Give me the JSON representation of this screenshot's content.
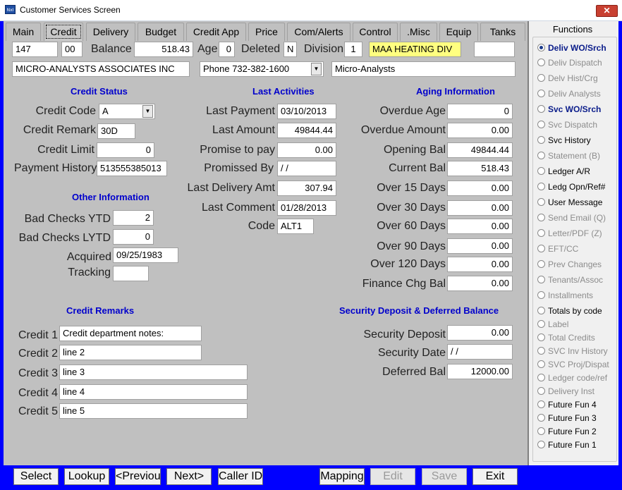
{
  "window": {
    "title": "Customer Services Screen",
    "icon": "app-icon",
    "close_label": "✕"
  },
  "tabs": [
    {
      "label": "Main",
      "hotkey": "M"
    },
    {
      "label": "Credit",
      "active": true
    },
    {
      "label": "Delivery"
    },
    {
      "label": "Budget"
    },
    {
      "label": "Credit App"
    },
    {
      "label": "Price"
    },
    {
      "label": "Com/Alerts"
    },
    {
      "label": "Control"
    },
    {
      "label": ".Misc"
    },
    {
      "label": "Equip"
    },
    {
      "label": "Tanks"
    }
  ],
  "header": {
    "account": "147",
    "sub": "00",
    "balance_label": "Balance",
    "balance": "518.43",
    "age_label": "Age",
    "age": "0",
    "deleted_label": "Deleted",
    "deleted": "N",
    "division_label": "Division",
    "division": "1",
    "division_name": "MAA HEATING  DIV",
    "extra": "",
    "customer_name": "MICRO-ANALYSTS ASSOCIATES INC",
    "phone": "Phone 732-382-1600",
    "short_name": "Micro-Analysts"
  },
  "credit_status": {
    "title": "Credit Status",
    "code_label": "Credit Code",
    "code": "A",
    "remark_label": "Credit Remark",
    "remark": "30D",
    "limit_label": "Credit Limit",
    "limit": "0",
    "history_label": "Payment History",
    "history": "513555385013"
  },
  "other_info": {
    "title": "Other Information",
    "bad_ytd_label": "Bad Checks YTD",
    "bad_ytd": "2",
    "bad_lytd_label": "Bad Checks LYTD",
    "bad_lytd": "0",
    "acquired_label": "Acquired",
    "acquired": "09/25/1983",
    "tracking_label": "Tracking",
    "tracking": ""
  },
  "last_activities": {
    "title": "Last Activities",
    "rows": [
      {
        "label": "Last Payment",
        "value": "03/10/2013"
      },
      {
        "label": "Last Amount",
        "value": "49844.44"
      },
      {
        "label": "Promise to pay",
        "value": "0.00"
      },
      {
        "label": "Promissed By",
        "value": " / /"
      },
      {
        "label": "Last Delivery Amt",
        "value": "307.94"
      },
      {
        "label": "Last Comment",
        "value": "01/28/2013"
      },
      {
        "label": "Code",
        "value": "ALT1"
      }
    ]
  },
  "aging": {
    "title": "Aging Information",
    "rows": [
      {
        "label": "Overdue Age",
        "value": "0"
      },
      {
        "label": "Overdue Amount",
        "value": "0.00"
      },
      {
        "label": "Opening Bal",
        "value": "49844.44"
      },
      {
        "label": "Current Bal",
        "value": "518.43"
      },
      {
        "label": "Over 15 Days",
        "value": "0.00"
      },
      {
        "label": "Over 30 Days",
        "value": "0.00"
      },
      {
        "label": "Over 60 Days",
        "value": "0.00"
      },
      {
        "label": "Over 90 Days",
        "value": "0.00"
      },
      {
        "label": "Over 120 Days",
        "value": "0.00"
      },
      {
        "label": "Finance Chg Bal",
        "value": "0.00"
      }
    ]
  },
  "credit_remarks": {
    "title": "Credit Remarks",
    "rows": [
      {
        "label": "Credit 1",
        "value": "Credit department notes:"
      },
      {
        "label": "Credit 2",
        "value": "line 2"
      },
      {
        "label": "Credit 3",
        "value": "line 3"
      },
      {
        "label": "Credit 4",
        "value": "line 4"
      },
      {
        "label": "Credit 5",
        "value": "line 5"
      }
    ]
  },
  "security": {
    "title": "Security Deposit & Deferred Balance",
    "rows": [
      {
        "label": "Security Deposit",
        "value": "0.00"
      },
      {
        "label": "Security Date",
        "value": " / /"
      },
      {
        "label": "Deferred Bal",
        "value": "12000.00"
      }
    ]
  },
  "functions": {
    "title": "Functions",
    "items": [
      {
        "label": "Deliv WO/Srch",
        "state": "selected"
      },
      {
        "label": "Deliv Dispatch",
        "state": "disabled"
      },
      {
        "label": "Delv Hist/Crg",
        "state": "disabled"
      },
      {
        "label": "Deliv Analysts",
        "state": "disabled"
      },
      {
        "label": "Svc WO/Srch",
        "state": "bold"
      },
      {
        "label": "Svc Dispatch",
        "state": "disabled"
      },
      {
        "label": "Svc History",
        "state": "enabled"
      },
      {
        "label": "Statement (B)",
        "state": "disabled"
      },
      {
        "label": "Ledger A/R",
        "state": "enabled"
      },
      {
        "label": "Ledg Opn/Ref#",
        "state": "enabled"
      },
      {
        "label": "User Message",
        "state": "enabled"
      },
      {
        "label": "Send Email (Q)",
        "state": "disabled"
      },
      {
        "label": "Letter/PDF (Z)",
        "state": "disabled"
      },
      {
        "label": "EFT/CC",
        "state": "disabled"
      },
      {
        "label": "Prev Changes",
        "state": "disabled"
      },
      {
        "label": "Tenants/Assoc",
        "state": "disabled"
      },
      {
        "label": "Installments",
        "state": "disabled"
      },
      {
        "label": "Totals by code",
        "state": "enabled"
      },
      {
        "label": "Label",
        "state": "disabled"
      },
      {
        "label": "Total Credits",
        "state": "disabled"
      },
      {
        "label": "SVC Inv History",
        "state": "disabled"
      },
      {
        "label": "SVC Proj/Dispat",
        "state": "disabled"
      },
      {
        "label": "Ledger code/ref",
        "state": "disabled"
      },
      {
        "label": "Delivery Inst",
        "state": "disabled"
      },
      {
        "label": "Future Fun 4",
        "state": "enabled"
      },
      {
        "label": "Future Fun 3",
        "state": "enabled"
      },
      {
        "label": "Future Fun 2",
        "state": "enabled"
      },
      {
        "label": "Future Fun 1",
        "state": "enabled"
      }
    ]
  },
  "buttons": [
    {
      "label": "Select",
      "enabled": true
    },
    {
      "label": "Lookup",
      "enabled": true
    },
    {
      "label": "<Previou",
      "enabled": true
    },
    {
      "label": "Next>",
      "enabled": true
    },
    {
      "label": "Caller ID",
      "enabled": true
    },
    {
      "label": "Mapping",
      "enabled": true
    },
    {
      "label": "Edit",
      "enabled": false
    },
    {
      "label": "Save",
      "enabled": false
    },
    {
      "label": "Exit",
      "enabled": true
    }
  ],
  "colors": {
    "frame": "#0000ff",
    "panel": "#c0c0c0",
    "section_title": "#0000cc",
    "highlight": "#ffff80"
  }
}
